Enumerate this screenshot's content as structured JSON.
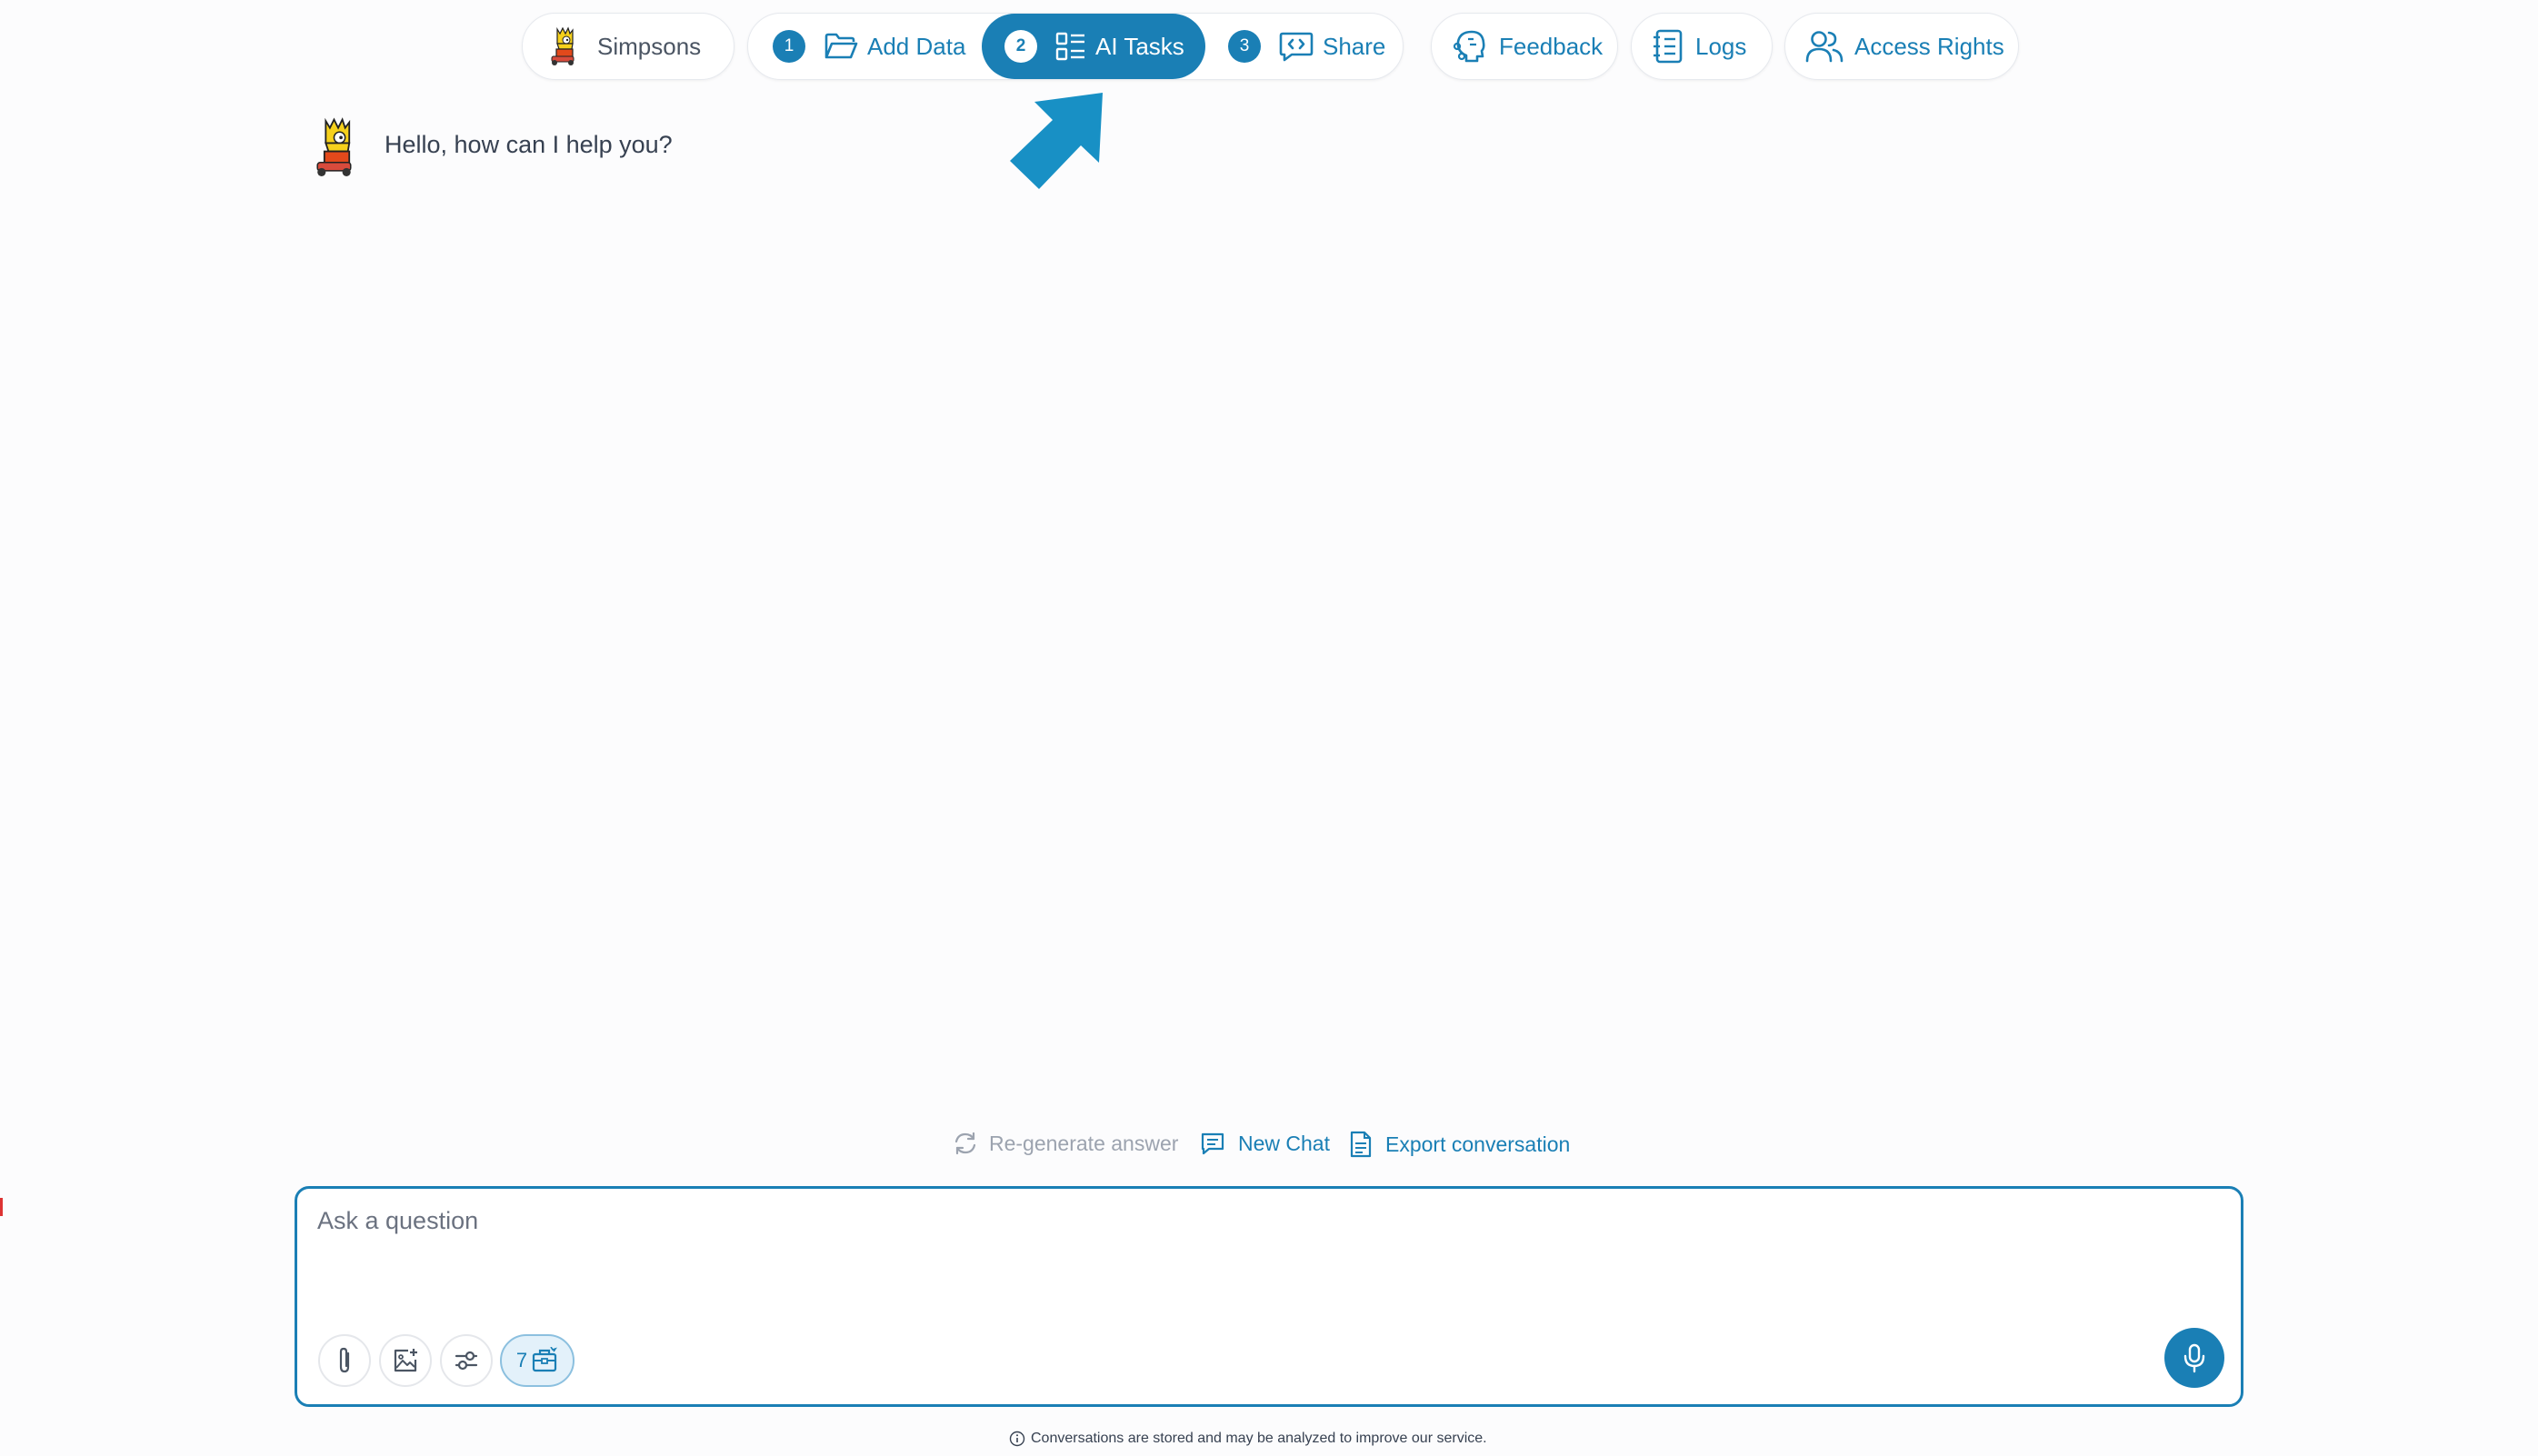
{
  "nav": {
    "workspace": {
      "label": "Simpsons",
      "avatar_icon": "bart-avatar-icon"
    },
    "steps": [
      {
        "number": "1",
        "label": "Add Data",
        "icon": "folder-icon"
      },
      {
        "number": "2",
        "label": "AI Tasks",
        "icon": "task-list-icon",
        "active": true
      },
      {
        "number": "3",
        "label": "Share",
        "icon": "code-chat-icon"
      }
    ],
    "feedback": {
      "label": "Feedback",
      "icon": "feedback-brain-icon"
    },
    "logs": {
      "label": "Logs",
      "icon": "notebook-icon"
    },
    "access_rights": {
      "label": "Access Rights",
      "icon": "users-icon"
    }
  },
  "chat": {
    "bot_avatar_icon": "bart-avatar-icon",
    "greeting": "Hello, how can I help you?"
  },
  "actions": {
    "regenerate": "Re-generate answer",
    "new_chat": "New Chat",
    "export": "Export conversation"
  },
  "input": {
    "placeholder": "Ask a question",
    "value": "",
    "tasks_count": "7",
    "tools": [
      "attach-icon",
      "add-image-icon",
      "settings-sliders-icon",
      "task-briefcase-icon"
    ],
    "mic_icon": "microphone-icon"
  },
  "disclaimer": "Conversations are stored and may be analyzed to improve our service.",
  "colors": {
    "accent": "#1a7fb5",
    "arrow": "#1890c5",
    "background": "#fcfcfd"
  }
}
